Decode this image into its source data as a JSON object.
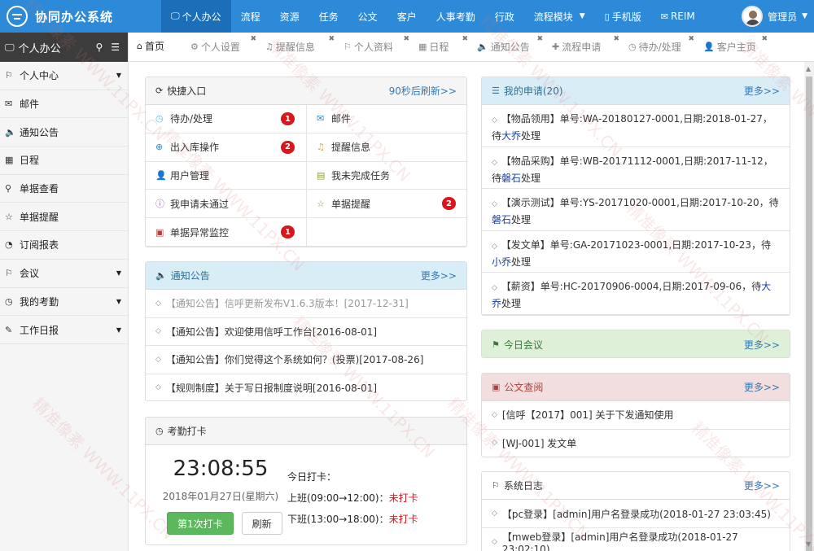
{
  "app": {
    "title": "协同办公系统"
  },
  "topnav": [
    {
      "label": "个人办公",
      "icon": "monitor",
      "active": true
    },
    {
      "label": "流程"
    },
    {
      "label": "资源"
    },
    {
      "label": "任务"
    },
    {
      "label": "公文"
    },
    {
      "label": "客户"
    },
    {
      "label": "人事考勤"
    },
    {
      "label": "行政"
    },
    {
      "label": "流程模块",
      "caret": true
    },
    {
      "label": "手机版",
      "icon": "mobile"
    },
    {
      "label": "REIM",
      "icon": "chat"
    }
  ],
  "user": {
    "name": "管理员"
  },
  "sidebar": {
    "header": "个人办公",
    "items": [
      {
        "label": "个人中心",
        "icon": "bookmark",
        "caret": true
      },
      {
        "label": "邮件",
        "icon": "envelope"
      },
      {
        "label": "通知公告",
        "icon": "volume"
      },
      {
        "label": "日程",
        "icon": "calendar"
      },
      {
        "label": "单据查看",
        "icon": "search"
      },
      {
        "label": "单据提醒",
        "icon": "star"
      },
      {
        "label": "订阅报表",
        "icon": "rss"
      },
      {
        "label": "会议",
        "icon": "bookmark",
        "caret": true
      },
      {
        "label": "我的考勤",
        "icon": "clock",
        "caret": true
      },
      {
        "label": "工作日报",
        "icon": "edit",
        "caret": true
      }
    ]
  },
  "tabs": [
    {
      "label": "首页",
      "icon": "home",
      "active": true
    },
    {
      "label": "个人设置",
      "icon": "gear",
      "closable": true
    },
    {
      "label": "提醒信息",
      "icon": "bell",
      "closable": true
    },
    {
      "label": "个人资料",
      "icon": "bookmark",
      "closable": true
    },
    {
      "label": "日程",
      "icon": "calendar",
      "closable": true
    },
    {
      "label": "通知公告",
      "icon": "volume",
      "closable": true
    },
    {
      "label": "流程申请",
      "icon": "plus",
      "closable": true
    },
    {
      "label": "待办/处理",
      "icon": "clock",
      "closable": true
    },
    {
      "label": "客户主页",
      "icon": "user",
      "closable": true
    }
  ],
  "quick": {
    "title": "快捷入口",
    "refresh": "90秒后刷新>>",
    "cells": [
      {
        "label": "待办/处理",
        "icon": "clock",
        "badge": "1"
      },
      {
        "label": "邮件",
        "icon": "envelope"
      },
      {
        "label": "出入库操作",
        "icon": "plus-circle",
        "badge": "2"
      },
      {
        "label": "提醒信息",
        "icon": "bell"
      },
      {
        "label": "用户管理",
        "icon": "user"
      },
      {
        "label": "我未完成任务",
        "icon": "task"
      },
      {
        "label": "我申请未通过",
        "icon": "info"
      },
      {
        "label": "单据提醒",
        "icon": "star",
        "badge": "2"
      },
      {
        "label": "单据异常监控",
        "icon": "briefcase",
        "badge": "1"
      },
      {
        "label": ""
      }
    ]
  },
  "notice": {
    "title": "通知公告",
    "more": "更多>>",
    "items": [
      {
        "text": "【通知公告】信呼更新发布V1.6.3版本！[2017-12-31]",
        "muted": true
      },
      {
        "text": "【通知公告】欢迎使用信呼工作台[2016-08-01]"
      },
      {
        "text": "【通知公告】你们觉得这个系统如何？(投票)[2017-08-26]"
      },
      {
        "text": "【规则制度】关于写日报制度说明[2016-08-01]"
      }
    ]
  },
  "attendance": {
    "title": "考勤打卡",
    "time": "23:08:55",
    "date": "2018年01月27日(星期六)",
    "today_label": "今日打卡：",
    "on_label": "上班(09:00→12:00)：",
    "on_status": "未打卡",
    "off_label": "下班(13:00→18:00)：",
    "off_status": "未打卡",
    "punch_button": "第1次打卡",
    "refresh_button": "刷新"
  },
  "apply": {
    "title": "我的申请(20)",
    "more": "更多>>",
    "items": [
      {
        "pre": "【物品领用】单号:WA-20180127-0001,日期:2018-01-27，待",
        "who": "大乔",
        "post": "处理"
      },
      {
        "pre": "【物品采购】单号:WB-20171112-0001,日期:2017-11-12，待",
        "who": "磐石",
        "post": "处理"
      },
      {
        "pre": "【演示测试】单号:YS-20171020-0001,日期:2017-10-20，待",
        "who": "磐石",
        "post": "处理"
      },
      {
        "pre": "【发文单】单号:GA-20171023-0001,日期:2017-10-23，待",
        "who": "小乔",
        "post": "处理"
      },
      {
        "pre": "【薪资】单号:HC-20170906-0004,日期:2017-09-06，待",
        "who": "大乔",
        "post": "处理"
      }
    ]
  },
  "meeting": {
    "title": "今日会议",
    "more": "更多>>"
  },
  "doc": {
    "title": "公文查阅",
    "more": "更多>>",
    "items": [
      {
        "text": "[信呼【2017】001] 关于下发通知使用"
      },
      {
        "text": "[WJ-001] 发文单"
      }
    ]
  },
  "syslog": {
    "title": "系统日志",
    "more": "更多>>",
    "items": [
      {
        "text": "【pc登录】[admin]用户名登录成功(2018-01-27 23:03:45)"
      },
      {
        "text": "【mweb登录】[admin]用户名登录成功(2018-01-27 23:02:10)"
      }
    ]
  },
  "watermark": {
    "text": "精准像素 WWW.11PX.CN"
  },
  "colors": {
    "topbar": "#2d8ad8",
    "active_nav": "#1b6fb8",
    "badge": "#d9161b",
    "assignee": "#1a3faa"
  }
}
